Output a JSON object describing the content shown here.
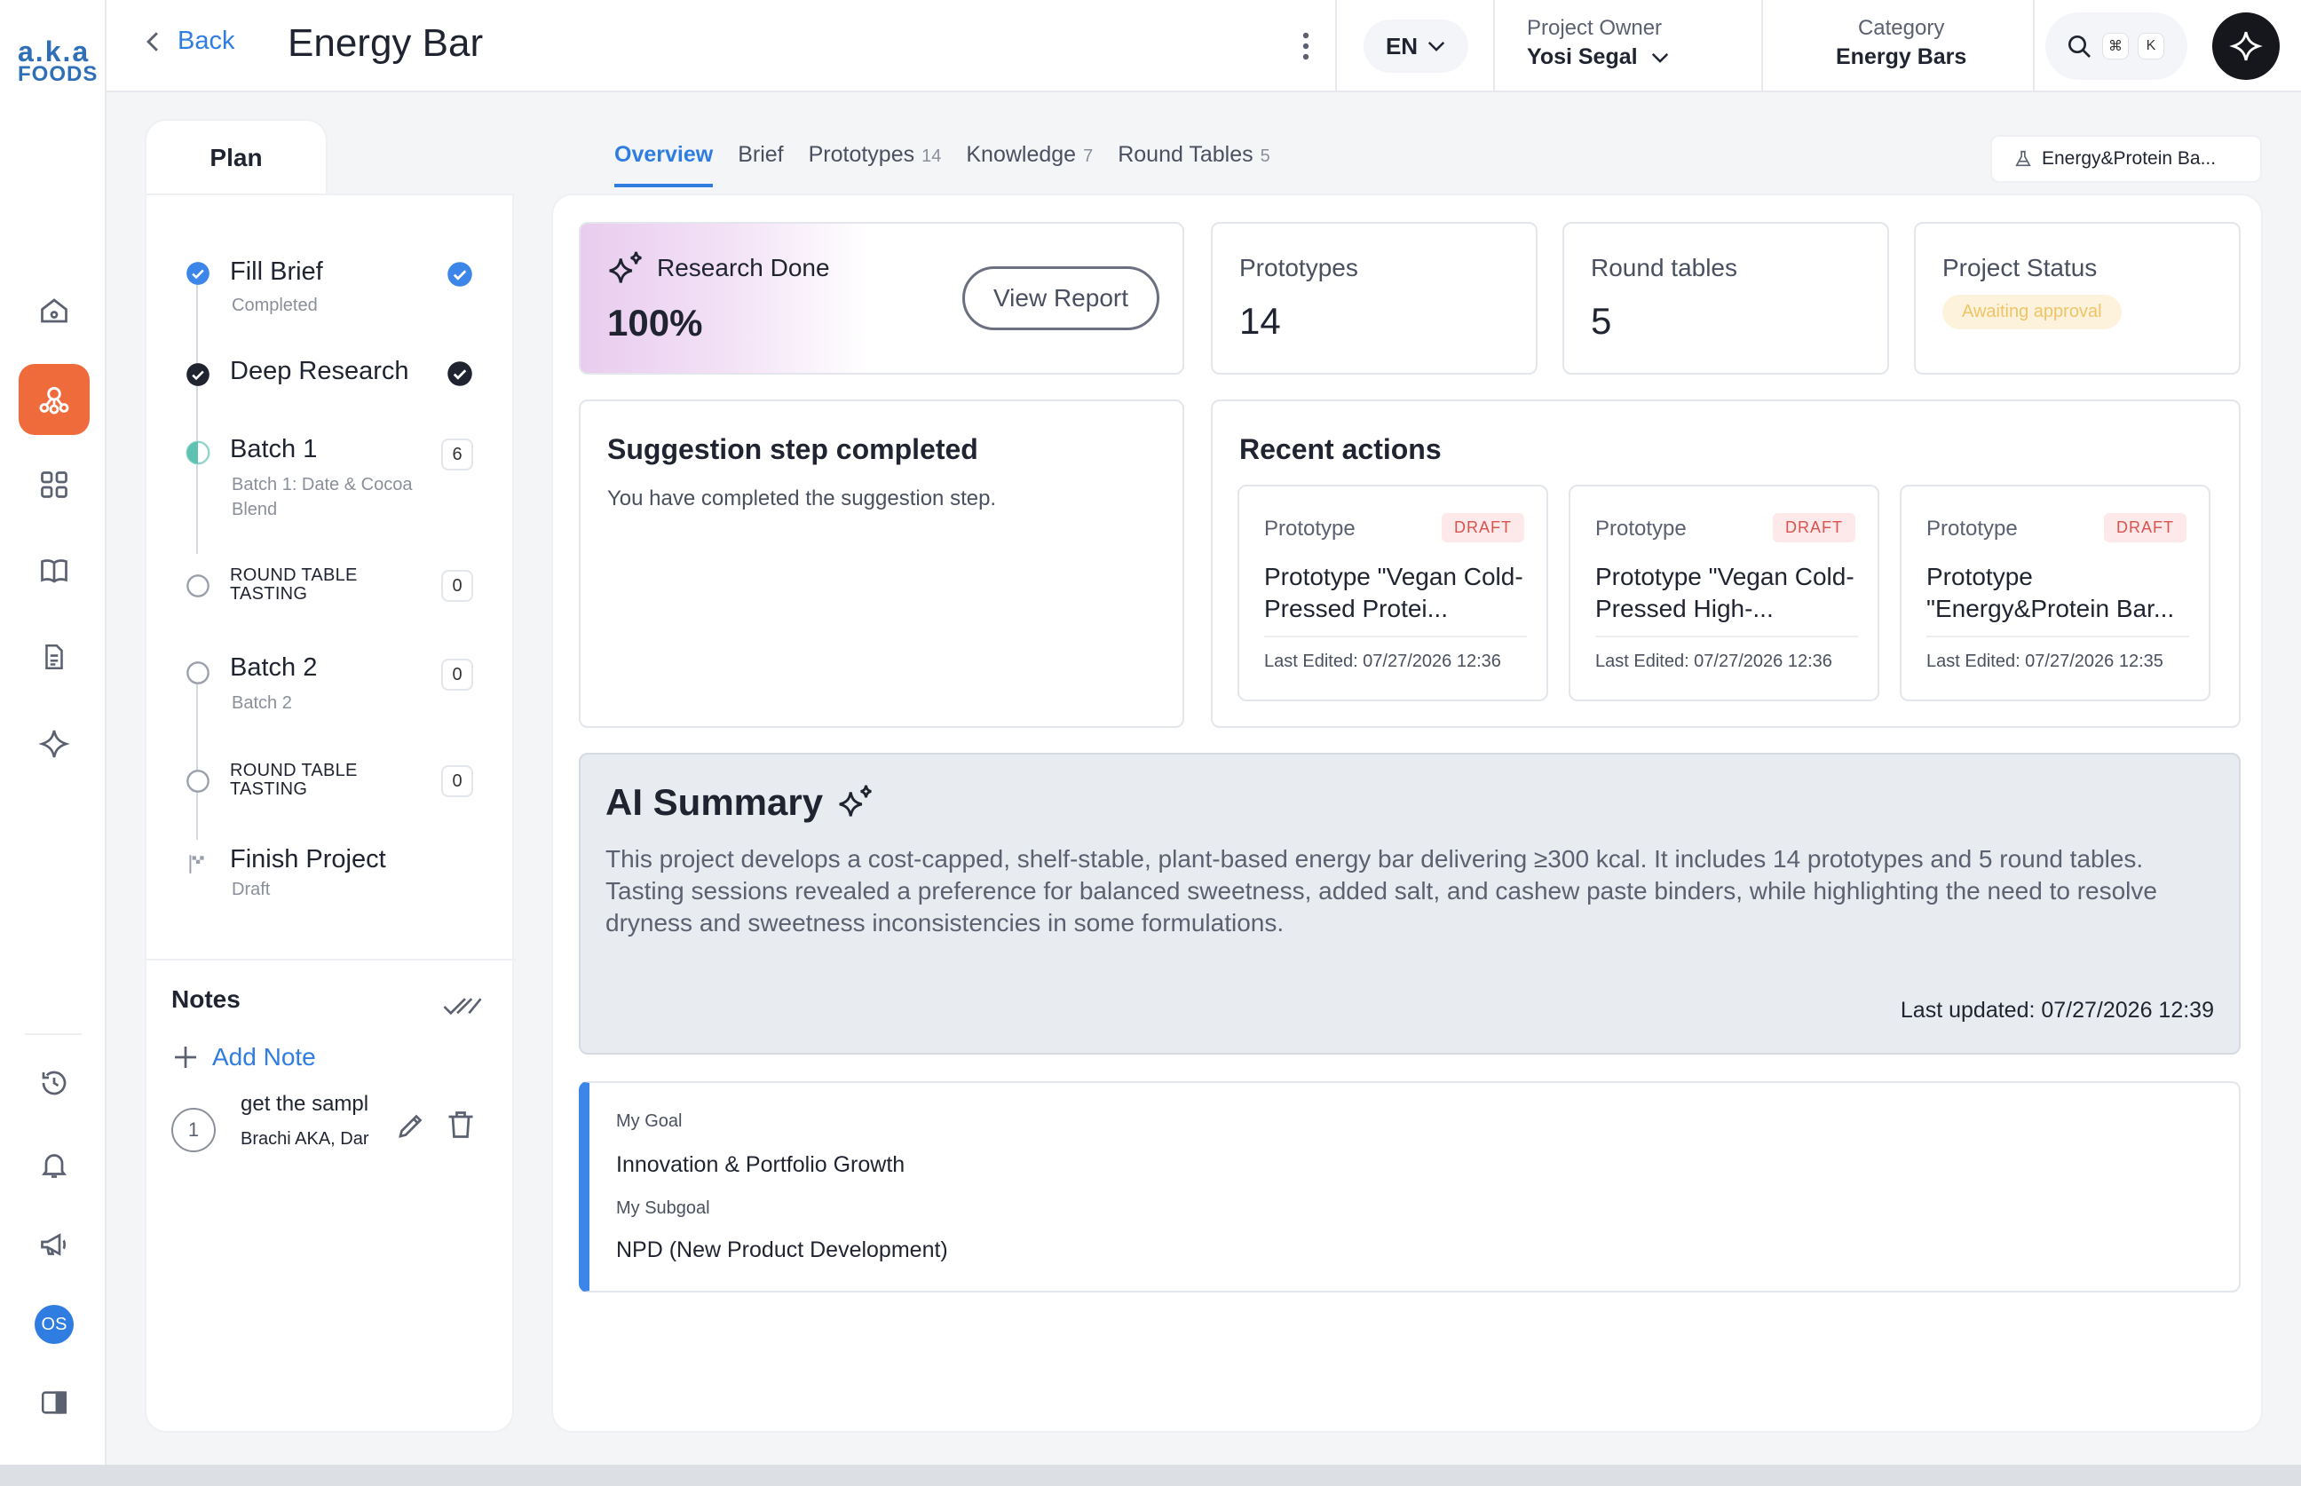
{
  "app": {
    "logo_line1": "a.k.a",
    "logo_line2": "FOODS",
    "avatar_initials": "OS"
  },
  "rail": {
    "items": [
      {
        "icon": "home-icon"
      },
      {
        "icon": "network-icon",
        "active": true
      },
      {
        "icon": "grid-icon"
      },
      {
        "icon": "book-icon"
      },
      {
        "icon": "document-icon"
      },
      {
        "icon": "sparkle-icon"
      },
      {
        "icon": "history-icon"
      },
      {
        "icon": "bell-icon"
      },
      {
        "icon": "megaphone-icon"
      },
      {
        "icon": "panel-toggle-icon"
      }
    ]
  },
  "header": {
    "back_label": "Back",
    "title": "Energy Bar",
    "language": "EN",
    "owner_label": "Project Owner",
    "owner_value": "Yosi Segal",
    "category_label": "Category",
    "category_value": "Energy Bars",
    "kbd1": "⌘",
    "kbd2": "K"
  },
  "plan": {
    "tab_label": "Plan",
    "steps": [
      {
        "title": "Fill Brief",
        "sub": "Completed",
        "state": "done-blue"
      },
      {
        "title": "Deep Research",
        "sub": "",
        "state": "done-dark"
      },
      {
        "title": "Batch 1",
        "sub": "Batch 1: Date & Cocoa Blend",
        "count": "6",
        "state": "half"
      },
      {
        "title": "ROUND TABLE TASTING",
        "sub": "",
        "count": "0",
        "state": "empty"
      },
      {
        "title": "Batch 2",
        "sub": "Batch 2",
        "count": "0",
        "state": "empty"
      },
      {
        "title": "ROUND TABLE TASTING",
        "sub": "",
        "count": "0",
        "state": "empty"
      },
      {
        "title": "Finish Project",
        "sub": "Draft",
        "state": "flag"
      }
    ]
  },
  "notes": {
    "title": "Notes",
    "add_label": "Add Note",
    "items": [
      {
        "num": "1",
        "text": "get the sampl",
        "meta": "Brachi AKA, Dar"
      }
    ]
  },
  "tabs": [
    {
      "label": "Overview",
      "count": "",
      "active": true
    },
    {
      "label": "Brief",
      "count": ""
    },
    {
      "label": "Prototypes",
      "count": "14"
    },
    {
      "label": "Knowledge",
      "count": "7"
    },
    {
      "label": "Round Tables",
      "count": "5"
    }
  ],
  "project_chip": "Energy&Protein Ba...",
  "stats": {
    "research_label": "Research Done",
    "research_value": "100%",
    "view_report": "View Report",
    "prototypes_label": "Prototypes",
    "prototypes_value": "14",
    "roundtables_label": "Round tables",
    "roundtables_value": "5",
    "status_label": "Project Status",
    "status_value": "Awaiting approval"
  },
  "suggestion": {
    "title": "Suggestion step completed",
    "text": "You have completed the suggestion step."
  },
  "recent": {
    "title": "Recent actions",
    "items": [
      {
        "type": "Prototype",
        "badge": "DRAFT",
        "name": "Prototype \"Vegan Cold-Pressed Protei...",
        "date": "Last Edited: 07/27/2026 12:36"
      },
      {
        "type": "Prototype",
        "badge": "DRAFT",
        "name": "Prototype \"Vegan Cold-Pressed High-...",
        "date": "Last Edited: 07/27/2026 12:36"
      },
      {
        "type": "Prototype",
        "badge": "DRAFT",
        "name": "Prototype \"Energy&Protein Bar...",
        "date": "Last Edited: 07/27/2026 12:35"
      }
    ]
  },
  "ai_summary": {
    "title": "AI Summary",
    "text": "This project develops a cost-capped, shelf-stable, plant-based energy bar delivering ≥300 kcal. It includes 14 prototypes and 5 round tables. Tasting sessions revealed a preference for balanced sweetness, added salt, and cashew paste binders, while highlighting the need to resolve dryness and sweetness inconsistencies in some formulations.",
    "updated": "Last updated: 07/27/2026 12:39"
  },
  "goal": {
    "goal_label": "My Goal",
    "goal_value": "Innovation & Portfolio Growth",
    "subgoal_label": "My Subgoal",
    "subgoal_value": "NPD (New Product Development)"
  },
  "colors": {
    "accent": "#2f7de1",
    "rail_active": "#f06b3b",
    "draft": "#d9534f",
    "status": "#f0c466",
    "goal_bar": "#3b86e8"
  }
}
